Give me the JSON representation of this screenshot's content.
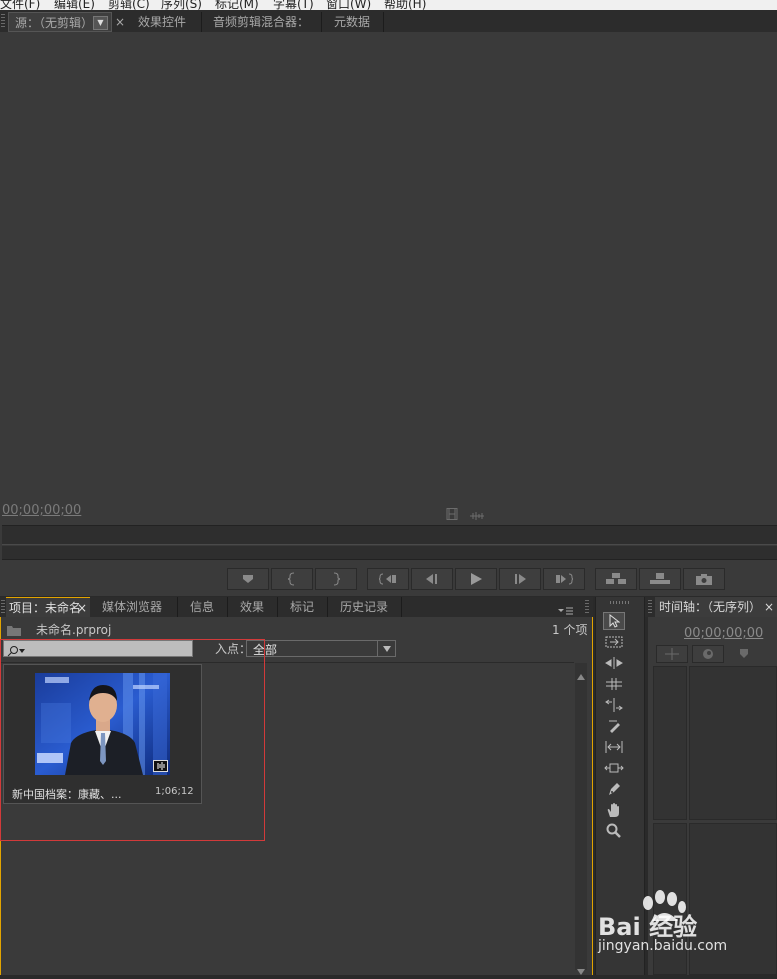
{
  "menu": [
    "文件(F)",
    "编辑(E)",
    "剪辑(C)",
    "序列(S)",
    "标记(M)",
    "字幕(T)",
    "窗口(W)",
    "帮助(H)"
  ],
  "source_panel": {
    "tabs": [
      "源：（无剪辑）",
      "效果控件",
      "音频剪辑混合器：",
      "元数据"
    ],
    "close_glyph": "×",
    "timecode": "00;00;00;00"
  },
  "project_panel": {
    "tabs": [
      "项目：未命名",
      "媒体浏览器",
      "信息",
      "效果",
      "标记",
      "历史记录"
    ],
    "close_glyph": "×",
    "project_file": "未命名.prproj",
    "item_count": "1 个项",
    "search_placeholder": "",
    "in_point_label": "入点：",
    "in_point_value": "全部",
    "clip": {
      "name": "新中国档案：康藏、...",
      "duration": "1;06;12"
    }
  },
  "timeline_panel": {
    "tab": "时间轴：（无序列）",
    "close_glyph": "×",
    "timecode": "00;00;00;00"
  },
  "watermark": {
    "brand": "Bai 经验",
    "url": "jingyan.baidu.com"
  },
  "colors": {
    "accent": "#e2a400",
    "highlight_box": "#d23a3a",
    "panel_bg": "#3a3a3a"
  }
}
